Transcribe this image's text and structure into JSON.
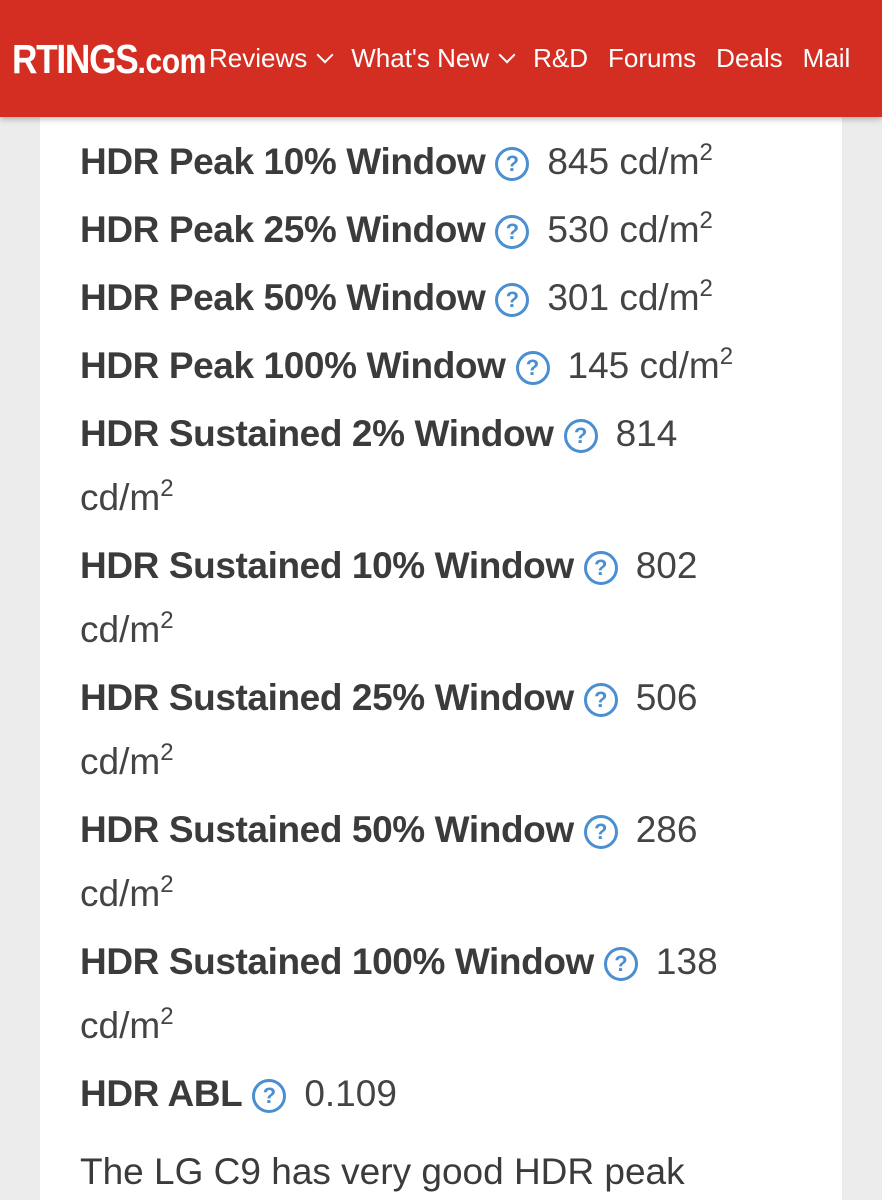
{
  "header": {
    "logo_main": "RTINGS",
    "logo_suffix": ".com",
    "nav": [
      {
        "label": "Reviews",
        "dropdown": true
      },
      {
        "label": "What's New",
        "dropdown": true
      },
      {
        "label": "R&D",
        "dropdown": false
      },
      {
        "label": "Forums",
        "dropdown": false
      },
      {
        "label": "Deals",
        "dropdown": false
      },
      {
        "label": "Mail",
        "dropdown": false
      }
    ],
    "brand_color": "#d42e22"
  },
  "help_icon": "?",
  "specs": [
    {
      "label": "HDR Peak 10% Window",
      "value": "845",
      "unit": "cd/m",
      "unit_sup": "2"
    },
    {
      "label": "HDR Peak 25% Window",
      "value": "530",
      "unit": "cd/m",
      "unit_sup": "2"
    },
    {
      "label": "HDR Peak 50% Window",
      "value": "301",
      "unit": "cd/m",
      "unit_sup": "2"
    },
    {
      "label": "HDR Peak 100% Window",
      "value": "145",
      "unit": "cd/m",
      "unit_sup": "2"
    },
    {
      "label": "HDR Sustained 2% Window",
      "value": "814",
      "unit": "cd/m",
      "unit_sup": "2"
    },
    {
      "label": "HDR Sustained 10% Window",
      "value": "802",
      "unit": "cd/m",
      "unit_sup": "2"
    },
    {
      "label": "HDR Sustained 25% Window",
      "value": "506",
      "unit": "cd/m",
      "unit_sup": "2"
    },
    {
      "label": "HDR Sustained 50% Window",
      "value": "286",
      "unit": "cd/m",
      "unit_sup": "2"
    },
    {
      "label": "HDR Sustained 100% Window",
      "value": "138",
      "unit": "cd/m",
      "unit_sup": "2"
    },
    {
      "label": "HDR ABL",
      "value": "0.109",
      "unit": "",
      "unit_sup": ""
    }
  ],
  "summary_text": "The LG C9 has very good HDR peak",
  "colors": {
    "help_icon": "#4a8fd1",
    "text": "#3b3b3b",
    "page_background": "#ececec"
  }
}
